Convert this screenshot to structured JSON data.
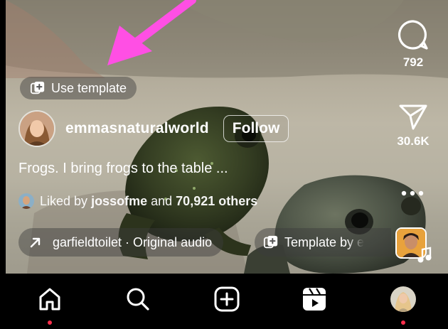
{
  "reel": {
    "use_template_label": "Use template",
    "username": "emmasnaturalworld",
    "follow_label": "Follow",
    "caption": "Frogs. I bring frogs to the table ...",
    "liked_prefix": "Liked by",
    "liked_user": "jossofme",
    "liked_and": "and",
    "liked_count": "70,921 others",
    "audio_label": "garfieldtoilet · Original audio",
    "template_by_label": "Template by e"
  },
  "actions": {
    "comment_count": "792",
    "share_count": "30.6K"
  },
  "nav": {
    "items": [
      "home-icon",
      "search-icon",
      "create-icon",
      "reels-icon",
      "profile-avatar"
    ],
    "notification_dot_color": "#ff2f4c"
  },
  "colors": {
    "annotation_arrow": "#ff4fe4",
    "nav_background": "#000000"
  }
}
